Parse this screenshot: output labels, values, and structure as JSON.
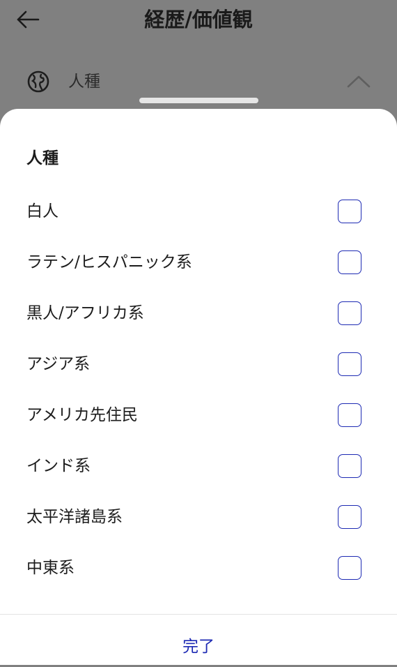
{
  "header": {
    "title": "経歴/価値観",
    "back_icon": "arrow-left-icon"
  },
  "background_row": {
    "icon": "globe-icon",
    "label": "人種",
    "chevron_icon": "chevron-up-icon"
  },
  "sheet": {
    "title": "人種",
    "options": [
      {
        "label": "白人",
        "checked": false
      },
      {
        "label": "ラテン/ヒスパニック系",
        "checked": false
      },
      {
        "label": "黒人/アフリカ系",
        "checked": false
      },
      {
        "label": "アジア系",
        "checked": false
      },
      {
        "label": "アメリカ先住民",
        "checked": false
      },
      {
        "label": "インド系",
        "checked": false
      },
      {
        "label": "太平洋諸島系",
        "checked": false
      },
      {
        "label": "中東系",
        "checked": false
      }
    ],
    "done_label": "完了"
  },
  "colors": {
    "accent": "#1d2ab3",
    "overlay": "#808080",
    "sheet_background": "#ffffff"
  }
}
